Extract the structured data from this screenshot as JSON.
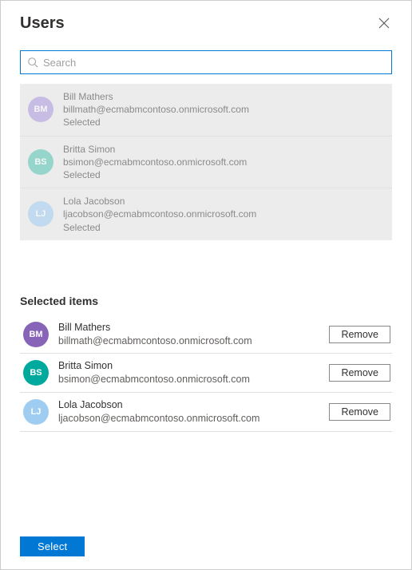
{
  "header": {
    "title": "Users"
  },
  "search": {
    "placeholder": "Search",
    "value": ""
  },
  "candidates": [
    {
      "initials": "BM",
      "name": "Bill Mathers",
      "email": "billmath@ecmabmcontoso.onmicrosoft.com",
      "status": "Selected",
      "color": "#a997df"
    },
    {
      "initials": "BS",
      "name": "Britta Simon",
      "email": "bsimon@ecmabmcontoso.onmicrosoft.com",
      "status": "Selected",
      "color": "#4fc3b1"
    },
    {
      "initials": "LJ",
      "name": "Lola Jacobson",
      "email": "ljacobson@ecmabmcontoso.onmicrosoft.com",
      "status": "Selected",
      "color": "#9fcdf2"
    }
  ],
  "selected_section": {
    "heading": "Selected items",
    "remove_label": "Remove",
    "items": [
      {
        "initials": "BM",
        "name": "Bill Mathers",
        "email": "billmath@ecmabmcontoso.onmicrosoft.com",
        "color": "#8764b8"
      },
      {
        "initials": "BS",
        "name": "Britta Simon",
        "email": "bsimon@ecmabmcontoso.onmicrosoft.com",
        "color": "#00a99d"
      },
      {
        "initials": "LJ",
        "name": "Lola Jacobson",
        "email": "ljacobson@ecmabmcontoso.onmicrosoft.com",
        "color": "#9fcdf2"
      }
    ]
  },
  "footer": {
    "select_label": "Select"
  }
}
